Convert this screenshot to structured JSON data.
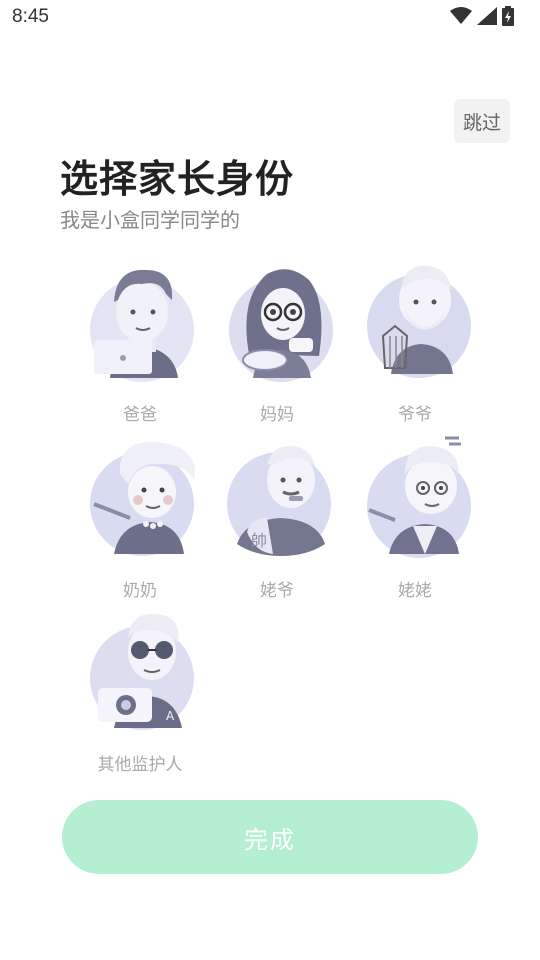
{
  "status_bar": {
    "time": "8:45",
    "icons": [
      "wifi-icon",
      "cell-signal-icon",
      "battery-charging-icon"
    ]
  },
  "header": {
    "skip_label": "跳过",
    "title": "选择家长身份",
    "subtitle": "我是小盒同学同学的"
  },
  "roles": [
    {
      "label": "爸爸",
      "avatar": "father-avatar"
    },
    {
      "label": "妈妈",
      "avatar": "mother-avatar"
    },
    {
      "label": "爷爷",
      "avatar": "paternal-grandfather-avatar"
    },
    {
      "label": "奶奶",
      "avatar": "paternal-grandmother-avatar"
    },
    {
      "label": "姥爷",
      "avatar": "maternal-grandfather-avatar"
    },
    {
      "label": "姥姥",
      "avatar": "maternal-grandmother-avatar"
    },
    {
      "label": "其他监护人",
      "avatar": "other-guardian-avatar"
    }
  ],
  "footer": {
    "done_label": "完成"
  },
  "colors": {
    "avatar_bg": "#d9dcf0",
    "avatar_dark": "#8a8ca8",
    "done_button": "#b4efd2"
  }
}
